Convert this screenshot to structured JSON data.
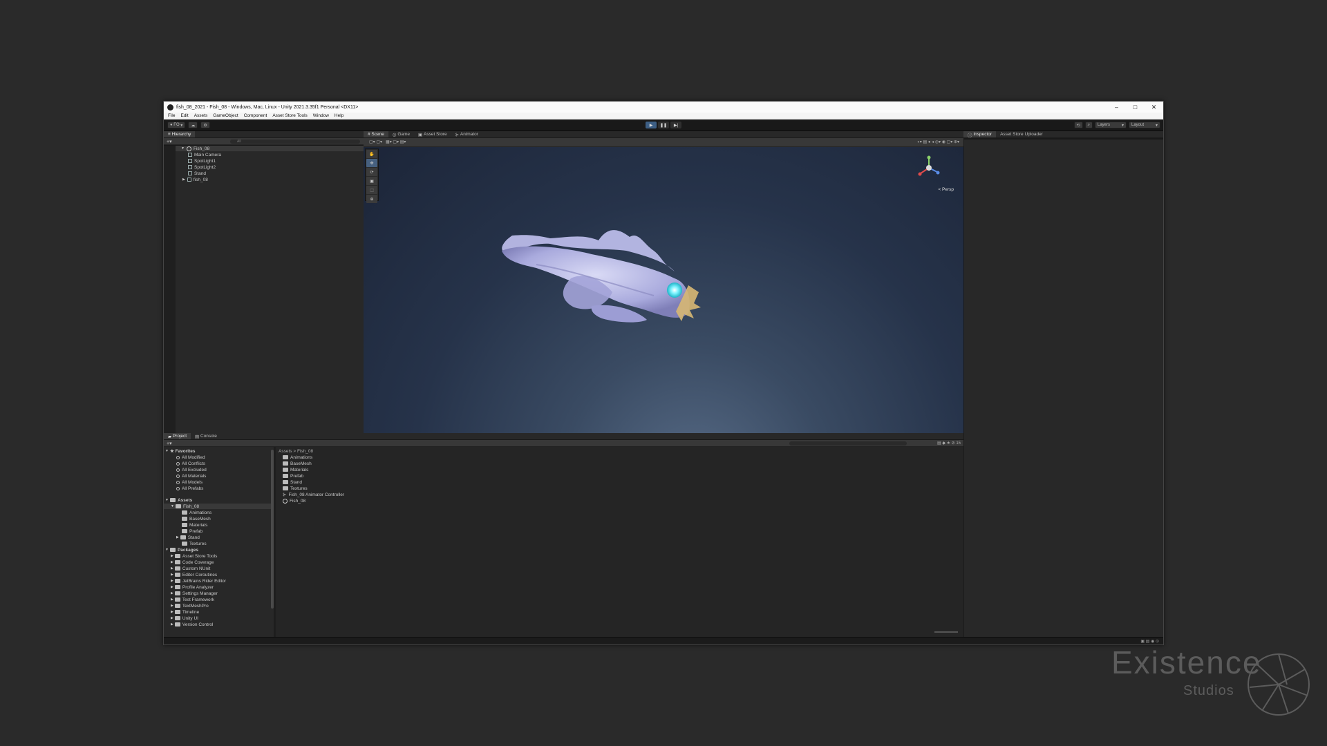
{
  "window": {
    "title": "fish_08_2021 - Fish_08 - Windows, Mac, Linux - Unity 2021.3.35f1 Personal <DX11>"
  },
  "menu": [
    "File",
    "Edit",
    "Assets",
    "GameObject",
    "Component",
    "Asset Store Tools",
    "Window",
    "Help"
  ],
  "toolbar": {
    "account": "FO",
    "layers": "Layers",
    "layout": "Layout"
  },
  "hierarchy": {
    "tab": "Hierarchy",
    "search_placeholder": "All",
    "items": [
      {
        "label": "Fish_08",
        "depth": 0
      },
      {
        "label": "Main Camera",
        "depth": 1
      },
      {
        "label": "SpotLight1",
        "depth": 1
      },
      {
        "label": "SpotLight2",
        "depth": 1
      },
      {
        "label": "Stand",
        "depth": 1
      },
      {
        "label": "fish_08",
        "depth": 1
      }
    ]
  },
  "scene": {
    "tabs": [
      "Scene",
      "Game",
      "Asset Store",
      "Animator"
    ],
    "persp": "< Persp"
  },
  "inspector": {
    "tabs": [
      "Inspector",
      "Asset Store Uploader"
    ]
  },
  "project": {
    "tabs": [
      "Project",
      "Console"
    ],
    "favorites_label": "Favorites",
    "favorites": [
      "All Modified",
      "All Conflicts",
      "All Excluded",
      "All Materials",
      "All Models",
      "All Prefabs"
    ],
    "assets_label": "Assets",
    "assets_tree": [
      "Fish_08",
      "Animations",
      "BaseMesh",
      "Materials",
      "Prefab",
      "Stand",
      "Textures"
    ],
    "packages_label": "Packages",
    "packages": [
      "Asset Store Tools",
      "Code Coverage",
      "Custom NUnit",
      "Editor Coroutines",
      "JetBrains Rider Editor",
      "Profile Analyzer",
      "Settings Manager",
      "Test Framework",
      "TextMeshPro",
      "Timeline",
      "Unity UI",
      "Version Control"
    ],
    "breadcrumb": [
      "Assets",
      ">",
      "Fish_08"
    ],
    "contents": [
      "Animations",
      "BaseMesh",
      "Materials",
      "Prefab",
      "Stand",
      "Textures",
      "Fish_08 Animator Controller",
      "Fish_08"
    ],
    "count": "15"
  },
  "watermark": {
    "line1": "Existence",
    "line2": "Studios"
  },
  "colors": {
    "accent": "#3d5f85",
    "eye": "#7ff4ff",
    "fish": "#b7b8e6"
  }
}
